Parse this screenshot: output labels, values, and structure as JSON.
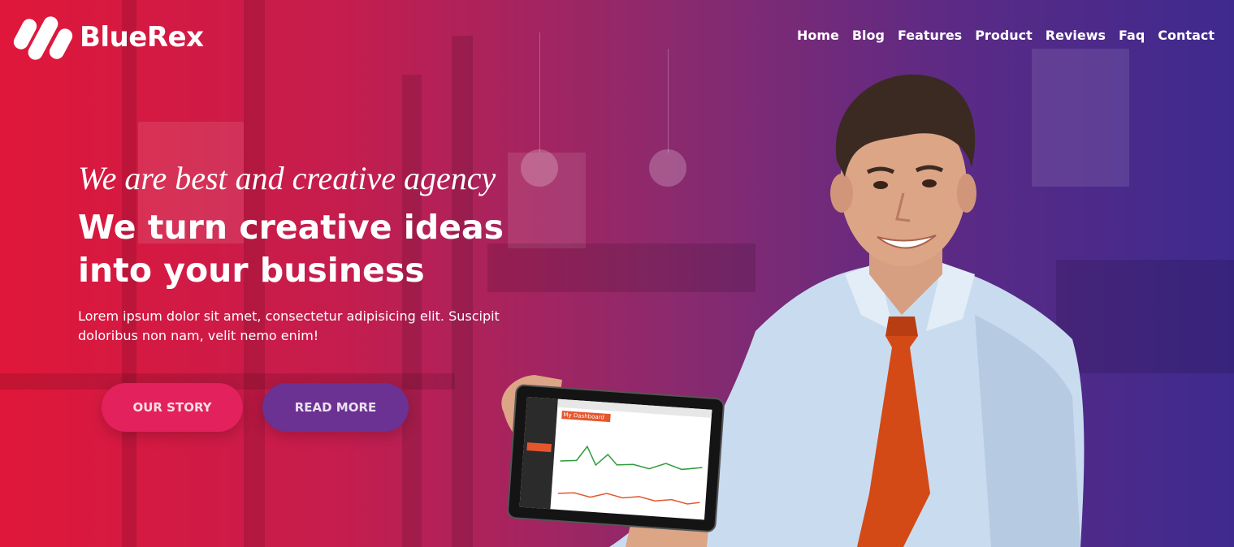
{
  "brand": {
    "name": "BlueRex",
    "logo_icon": "brand-stripes-icon"
  },
  "nav": {
    "items": [
      {
        "label": "Home"
      },
      {
        "label": "Blog"
      },
      {
        "label": "Features"
      },
      {
        "label": "Product"
      },
      {
        "label": "Reviews"
      },
      {
        "label": "Faq"
      },
      {
        "label": "Contact"
      }
    ]
  },
  "hero": {
    "tagline": "We are best and creative agency",
    "headline_line1": "We turn creative ideas",
    "headline_line2": "into your business",
    "lead": "Lorem ipsum dolor sit amet, consectetur adipisicing elit. Suscipit doloribus non nam, velit nemo enim!",
    "buttons": {
      "primary": "OUR STORY",
      "secondary": "READ MORE"
    }
  },
  "tablet": {
    "screen_title": "My Dashboard"
  },
  "colors": {
    "gradient_left": "#e0173a",
    "gradient_right": "#3e2a8e",
    "primary_button": "#e3215c",
    "secondary_button": "#6b3193",
    "text": "#ffffff"
  }
}
